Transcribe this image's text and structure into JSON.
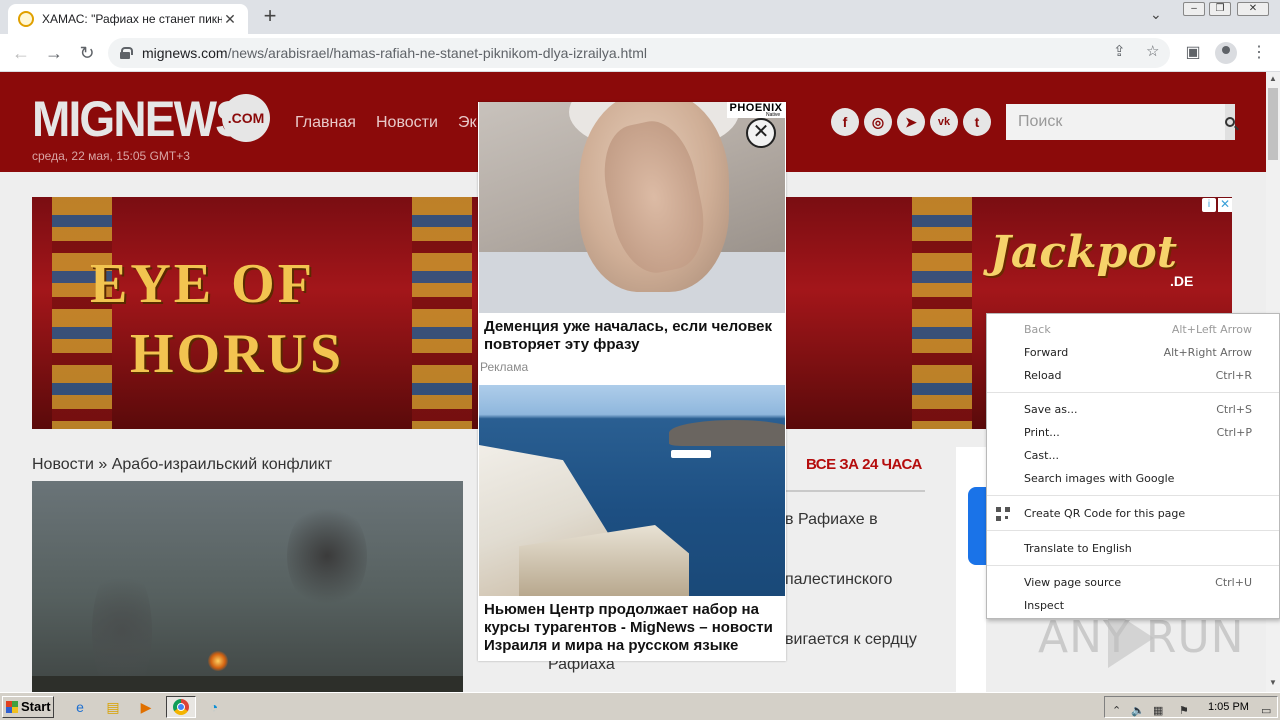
{
  "browser": {
    "tab_title": "ХАМАС: \"Рафиах не станет пикник",
    "tab_close": "✕",
    "new_tab": "+",
    "url_host": "mignews.com",
    "url_path": "/news/arabisrael/hamas-rafiah-ne-stanet-piknikom-dlya-izrailya.html"
  },
  "site": {
    "logo": "MIGNEWS",
    "logo_com": ".COM",
    "date": "среда, 22 мая, 15:05 GMT+3",
    "nav": [
      "Главная",
      "Новости",
      "Эк"
    ],
    "social": [
      "f",
      "◎",
      "➤",
      "vk",
      "t"
    ],
    "search_placeholder": "Поиск"
  },
  "banner": {
    "line1": "EYE OF",
    "line2": "HORUS",
    "brand": "Jackpot",
    "brand_sub": ".DE",
    "info": "i",
    "close": "✕"
  },
  "content": {
    "breadcrumb": "Новости » Арабо-израильский конфликт",
    "news24_title": "ВСЕ ЗА 24 ЧАСА",
    "news_items": [
      "в Рафиахе в",
      "палестинского",
      "вигается к сердцу",
      "Рафиаха"
    ]
  },
  "popup": {
    "brand": "PHOENIX",
    "brand_sub": "Native",
    "close": "✕",
    "headline1": "Деменция уже началась, если человек повторяет эту фразу",
    "ad_label": "Реклама",
    "headline2": "Ньюмен Центр продолжает набор на курсы турагентов - MigNews – новости Израиля и мира на русском языке"
  },
  "context_menu": {
    "items": [
      {
        "label": "Back",
        "shortcut": "Alt+Left Arrow",
        "disabled": true
      },
      {
        "label": "Forward",
        "shortcut": "Alt+Right Arrow"
      },
      {
        "label": "Reload",
        "shortcut": "Ctrl+R"
      },
      {
        "label": "Save as...",
        "shortcut": "Ctrl+S"
      },
      {
        "label": "Print...",
        "shortcut": "Ctrl+P"
      },
      {
        "label": "Cast..."
      },
      {
        "label": "Search images with Google"
      },
      {
        "label": "Create QR Code for this page"
      },
      {
        "label": "Translate to English"
      },
      {
        "label": "View page source",
        "shortcut": "Ctrl+U"
      },
      {
        "label": "Inspect"
      }
    ]
  },
  "watermark": "ANY RUN",
  "taskbar": {
    "start": "Start",
    "clock": "1:05 PM"
  }
}
